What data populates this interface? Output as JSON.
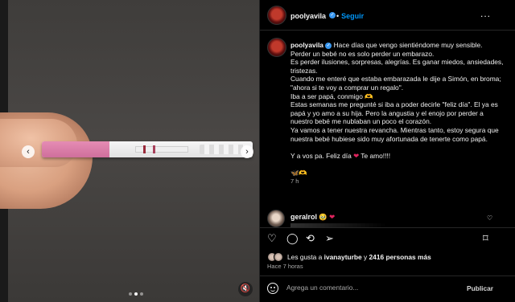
{
  "header": {
    "username": "poolyavila",
    "follow_label": "Seguir",
    "separator": "•",
    "more_icon": "..."
  },
  "caption": {
    "username": "poolyavila",
    "lines": [
      "Hace días que vengo sientiéndome muy sensible.",
      "Perder un bebé no es solo perder un embarazo.",
      "Es perder ilusiones, sorpresas, alegrías. Es ganar miedos, ansiedades, tristezas.",
      "Cuando me enteré que estaba embarazada le dije a Simón, en broma; \"ahora si te voy a comprar un regalo\".",
      "Iba a ser papá, conmigo 🫶",
      "Estas semanas me pregunté si iba a poder decirle \"feliz día\". El ya es papá y yo amo a su hija. Pero la angustia y el enojo por perder a nuestro bebé me nublaban un poco el corazón.",
      "Ya vamos a tener nuestra revancha. Mientras tanto, estoy segura que nuestra bebé hubiese sido muy afortunada de tenerte como papá."
    ],
    "closing_start": "Y a vos pa. Feliz día",
    "closing_end": "Te amo!!!!",
    "emojis": "🦋🫶",
    "time": "7 h"
  },
  "comment": {
    "username": "geralrol",
    "emoji": "🥹",
    "heart": "❤"
  },
  "likes": {
    "prefix": "Les gusta a",
    "user": "ivanayturbe",
    "connector": "y",
    "count": "2416 personas más"
  },
  "post_time": "Hace 7 horas",
  "comment_box": {
    "placeholder": "Agrega un comentario...",
    "publish_label": "Publicar"
  },
  "media": {
    "carousel_dots": 3,
    "active_dot": 1,
    "mute_icon": "🔇"
  },
  "colors": {
    "link": "#0095f6",
    "verified": "#3897f0",
    "heart": "#e0245e"
  }
}
